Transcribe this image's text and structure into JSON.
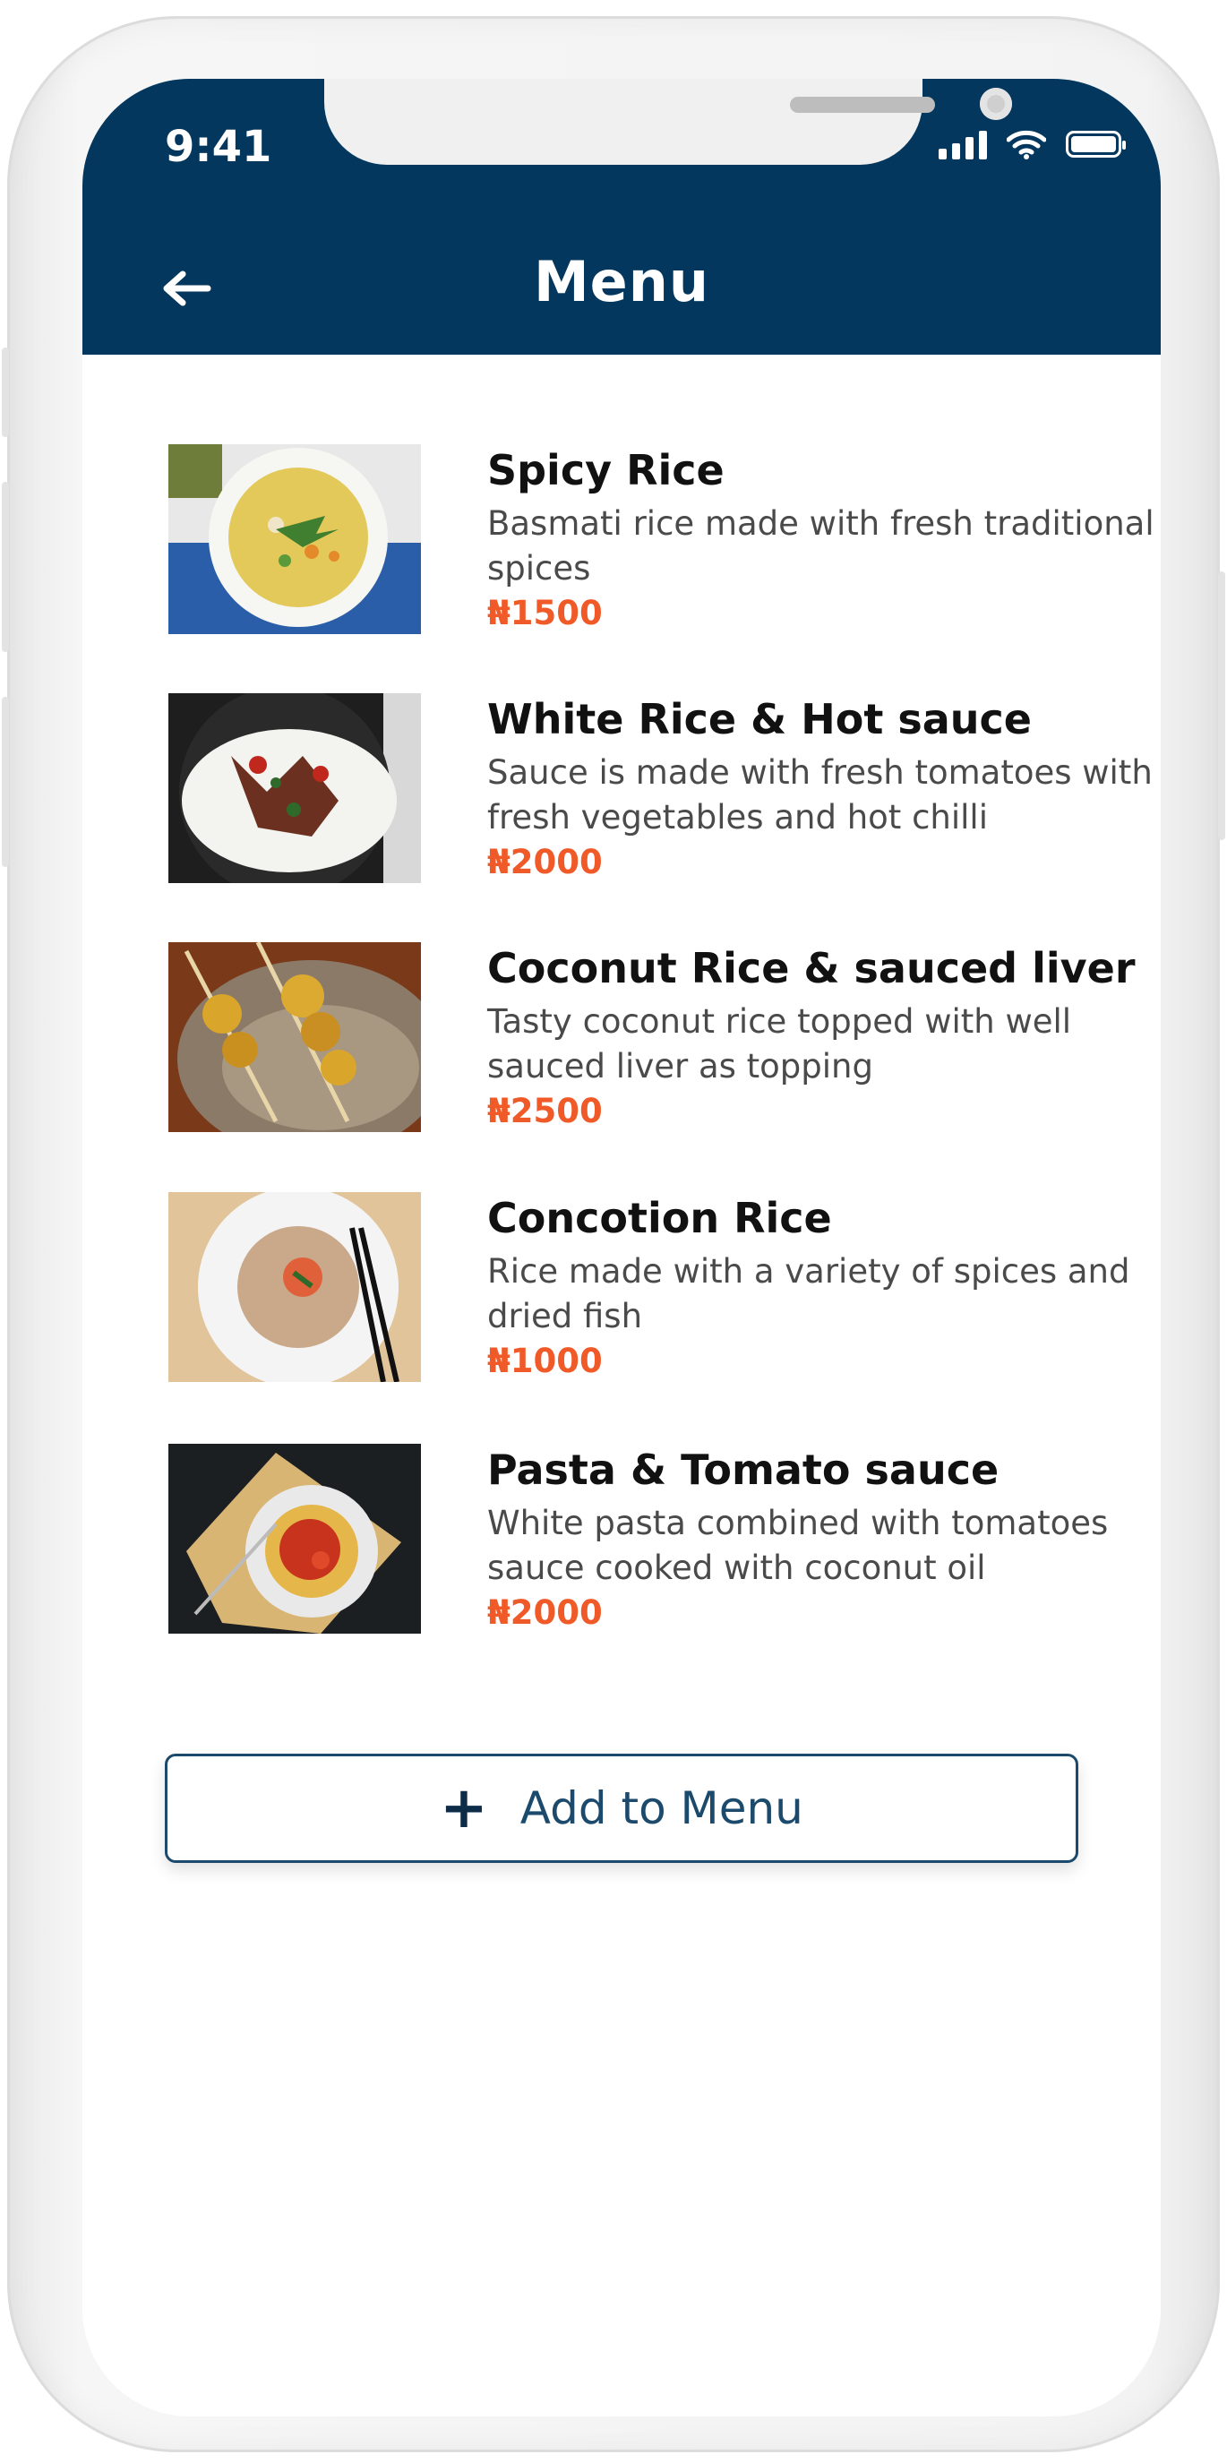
{
  "status_bar": {
    "time": "9:41"
  },
  "header": {
    "title": "Menu"
  },
  "menu_items": [
    {
      "name": "Spicy Rice",
      "description": "Basmati rice made with fresh traditional spices",
      "price": "₦1500"
    },
    {
      "name": "White Rice & Hot sauce",
      "description": "Sauce is made with fresh tomatoes with fresh vegetables and hot chilli",
      "price": "₦2000"
    },
    {
      "name": "Coconut Rice & sauced liver",
      "description": "Tasty coconut rice topped with well sauced liver as topping",
      "price": "₦2500"
    },
    {
      "name": "Concotion Rice",
      "description": "Rice made with a variety of spices and dried fish",
      "price": "₦1000"
    },
    {
      "name": "Pasta & Tomato sauce",
      "description": "White pasta combined with tomatoes sauce cooked with coconut oil",
      "price": "₦2000"
    }
  ],
  "add_button": {
    "label": "Add to Menu",
    "icon": "plus-icon"
  },
  "colors": {
    "header": "#04375e",
    "price": "#f05a28",
    "button_border": "#1c4a6c"
  }
}
